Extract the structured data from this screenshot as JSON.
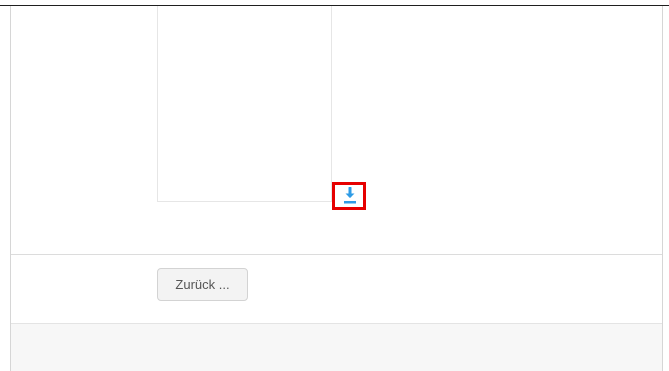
{
  "colors": {
    "accent": "#2e9be6",
    "highlight": "#e60000"
  },
  "toolbar": {
    "back_label": "Zurück ..."
  },
  "icons": {
    "download": "download-icon"
  }
}
